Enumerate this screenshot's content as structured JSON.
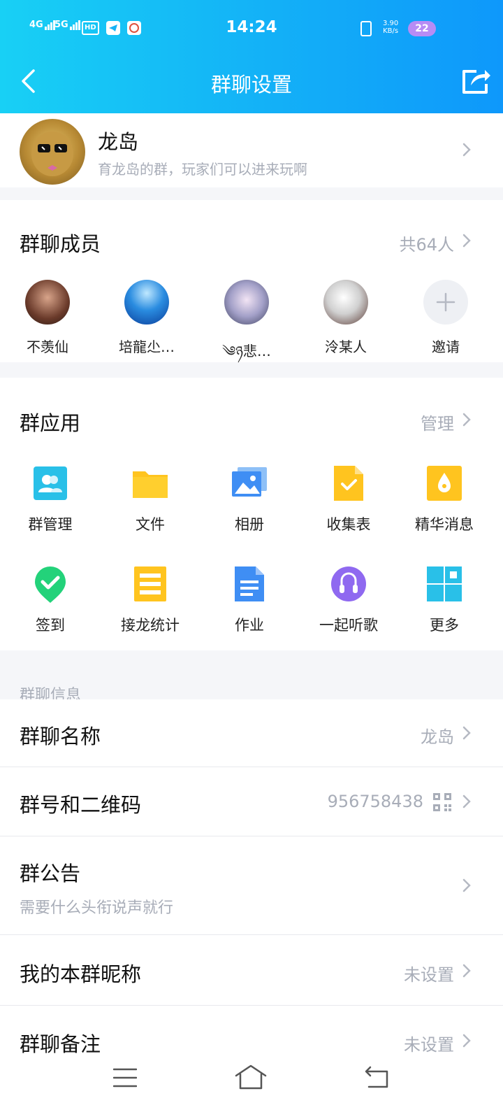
{
  "status_bar": {
    "signal_1": "4G",
    "signal_2": "5G",
    "hd": "HD",
    "time": "14:24",
    "net_speed_value": "3.90",
    "net_speed_unit": "KB/s",
    "battery": "22"
  },
  "header": {
    "title": "群聊设置"
  },
  "group": {
    "name": "龙岛",
    "description": "育龙岛的群，玩家们可以进来玩啊"
  },
  "members": {
    "title": "群聊成员",
    "count": "共64人",
    "list": [
      {
        "name": "不羡仙"
      },
      {
        "name": "培龍尐…"
      },
      {
        "name": "༄ཉ悲…"
      },
      {
        "name": "泠某人"
      },
      {
        "name": "邀请"
      }
    ]
  },
  "apps": {
    "title": "群应用",
    "manage": "管理",
    "items": [
      {
        "label": "群管理",
        "icon": "group-manage-icon"
      },
      {
        "label": "文件",
        "icon": "folder-icon"
      },
      {
        "label": "相册",
        "icon": "album-icon"
      },
      {
        "label": "收集表",
        "icon": "form-icon"
      },
      {
        "label": "精华消息",
        "icon": "essence-icon"
      },
      {
        "label": "签到",
        "icon": "checkin-icon"
      },
      {
        "label": "接龙统计",
        "icon": "relay-icon"
      },
      {
        "label": "作业",
        "icon": "homework-icon"
      },
      {
        "label": "一起听歌",
        "icon": "music-icon"
      },
      {
        "label": "更多",
        "icon": "more-grid-icon"
      }
    ]
  },
  "info": {
    "section_label": "群聊信息",
    "group_name_label": "群聊名称",
    "group_name_value": "龙岛",
    "group_number_label": "群号和二维码",
    "group_number_value": "956758438",
    "announcement_label": "群公告",
    "announcement_value": "需要什么头衔说声就行",
    "nickname_label": "我的本群昵称",
    "nickname_value": "未设置",
    "remark_label": "群聊备注",
    "remark_value": "未设置"
  },
  "colors": {
    "header_start": "#18d0f5",
    "header_end": "#0e98fb",
    "accent": "#12b7f5"
  }
}
